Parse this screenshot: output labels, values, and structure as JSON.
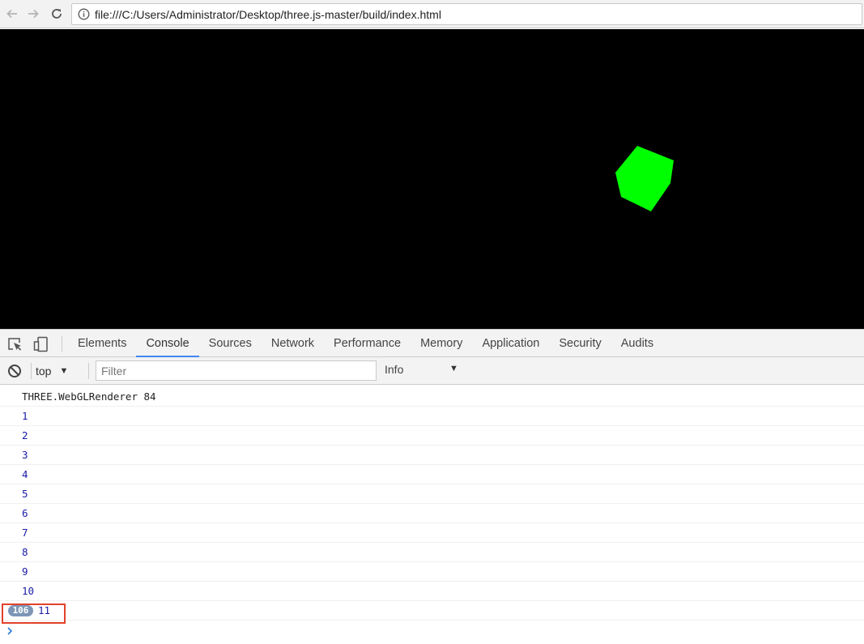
{
  "browser": {
    "url": "file:///C:/Users/Administrator/Desktop/three.js-master/build/index.html",
    "icons": {
      "back": "arrow-left-icon",
      "forward": "arrow-right-icon",
      "reload": "reload-icon",
      "info": "info-icon"
    }
  },
  "viewport": {
    "background": "#000000",
    "cube_color": "#00ff00"
  },
  "devtools": {
    "tabs": [
      {
        "label": "Elements"
      },
      {
        "label": "Console",
        "active": true
      },
      {
        "label": "Sources"
      },
      {
        "label": "Network"
      },
      {
        "label": "Performance"
      },
      {
        "label": "Memory"
      },
      {
        "label": "Application"
      },
      {
        "label": "Security"
      },
      {
        "label": "Audits"
      }
    ],
    "accent": "#4285f4",
    "toolbar": {
      "context": "top",
      "filter_placeholder": "Filter",
      "level": "Info"
    }
  },
  "console": {
    "messages": [
      {
        "text": "THREE.WebGLRenderer 84"
      },
      {
        "text": "1"
      },
      {
        "text": "2"
      },
      {
        "text": "3"
      },
      {
        "text": "4"
      },
      {
        "text": "5"
      },
      {
        "text": "6"
      },
      {
        "text": "7"
      },
      {
        "text": "8"
      },
      {
        "text": "9"
      },
      {
        "text": "10"
      },
      {
        "text": "11",
        "repeat_count": "106"
      }
    ],
    "number_color": "#1a1aa6",
    "badge_color": "#7d96b7",
    "highlight_color": "#e2422a"
  }
}
